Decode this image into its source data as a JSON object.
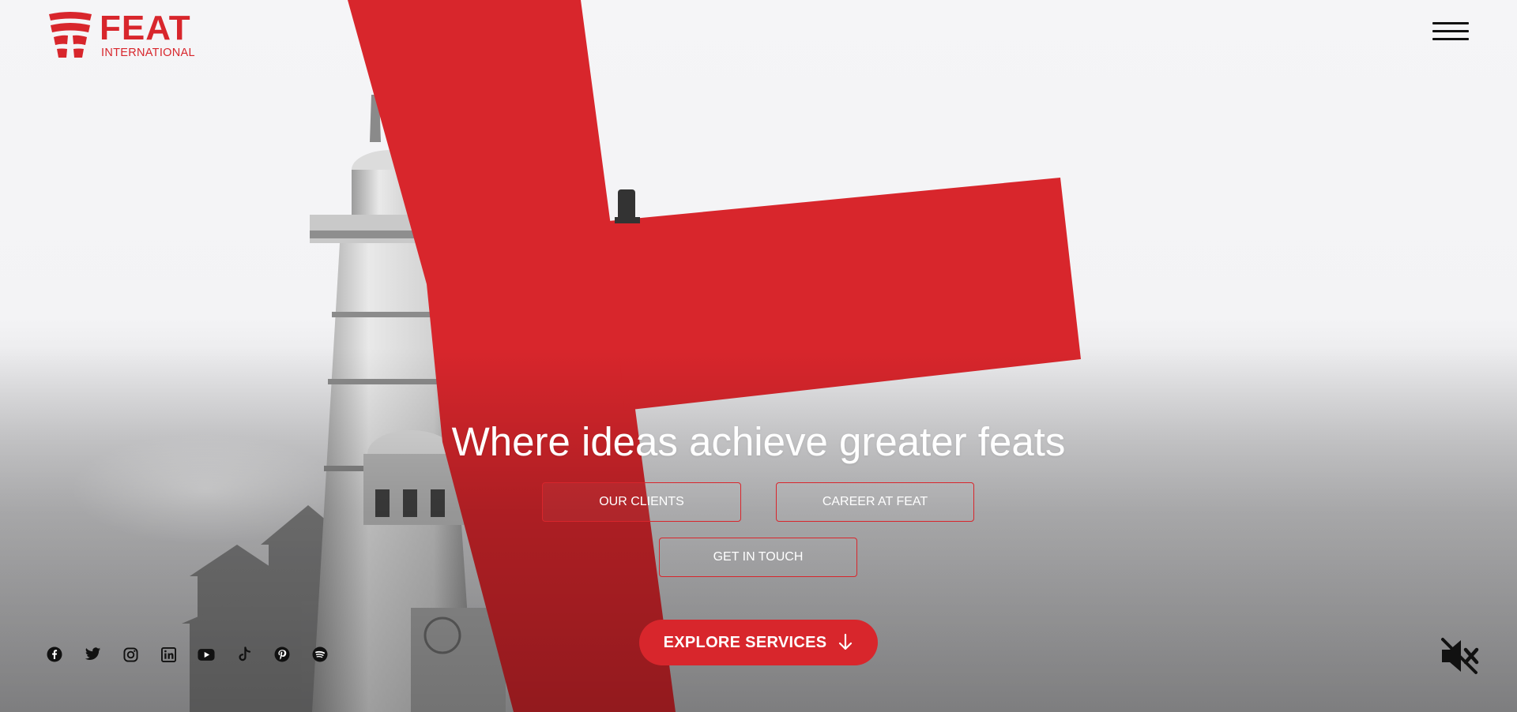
{
  "brand": {
    "logo_word": "FEAT",
    "logo_sub": "INTERNATIONAL",
    "accent_color": "#d8262c"
  },
  "nav": {
    "menu_icon": "hamburger-menu-icon"
  },
  "hero": {
    "headline": "Where ideas achieve greater feats",
    "buttons": {
      "clients": "OUR CLIENTS",
      "career": "CAREER AT FEAT",
      "contact": "GET IN TOUCH"
    },
    "cta": {
      "label": "EXPLORE SERVICES",
      "icon": "arrow-down-icon"
    }
  },
  "social": [
    {
      "icon": "facebook-icon"
    },
    {
      "icon": "twitter-icon"
    },
    {
      "icon": "instagram-icon"
    },
    {
      "icon": "linkedin-icon"
    },
    {
      "icon": "youtube-icon"
    },
    {
      "icon": "tiktok-icon"
    },
    {
      "icon": "pinterest-icon"
    },
    {
      "icon": "spotify-icon"
    }
  ],
  "media": {
    "sound_icon": "speaker-muted-icon"
  }
}
